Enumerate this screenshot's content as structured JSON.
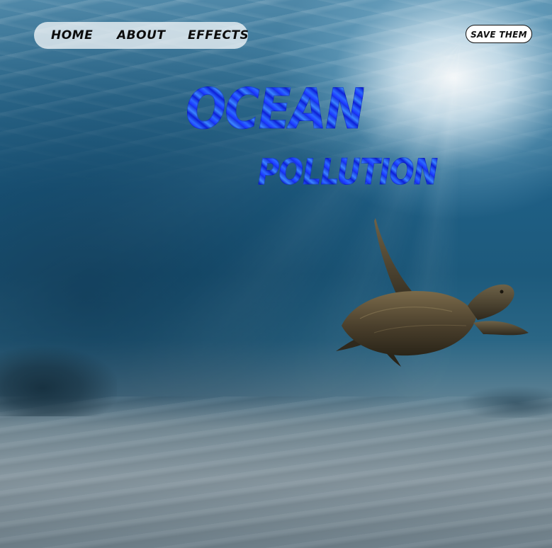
{
  "nav": {
    "items": [
      {
        "label": "HOME"
      },
      {
        "label": "ABOUT"
      },
      {
        "label": "EFFECTS"
      }
    ],
    "cta_label": "SAVE THEM"
  },
  "hero": {
    "title_line1": "OCEAN",
    "title_line2": "POLLUTION"
  },
  "colors": {
    "title_blue": "#1a3bff",
    "water_deep": "#1d5a7c",
    "sand": "#8797a0",
    "nav_pill": "#ffffffb8"
  },
  "icons": {
    "hero_image": "sea-turtle"
  }
}
